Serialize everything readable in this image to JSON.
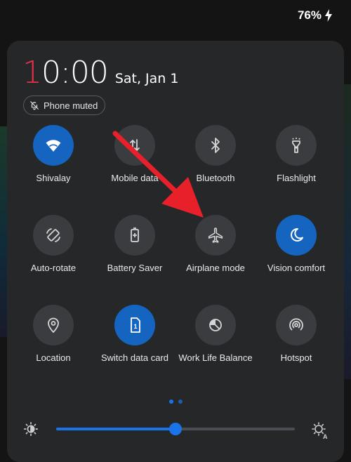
{
  "status_bar": {
    "battery_text": "76%",
    "battery_icon": "charging-bolt-icon"
  },
  "header": {
    "time_first_char": "1",
    "time_rest": "0:00",
    "date": "Sat, Jan 1",
    "chip": {
      "label": "Phone muted",
      "icon": "bell-off-icon"
    }
  },
  "tiles": [
    {
      "label": "Shivalay",
      "icon": "wifi-icon",
      "active": true
    },
    {
      "label": "Mobile data",
      "icon": "mobile-data-icon",
      "active": false
    },
    {
      "label": "Bluetooth",
      "icon": "bluetooth-icon",
      "active": false
    },
    {
      "label": "Flashlight",
      "icon": "flashlight-icon",
      "active": false
    },
    {
      "label": "Auto-rotate",
      "icon": "auto-rotate-icon",
      "active": false
    },
    {
      "label": "Battery Saver",
      "icon": "battery-saver-icon",
      "active": false
    },
    {
      "label": "Airplane mode",
      "icon": "airplane-icon",
      "active": false
    },
    {
      "label": "Vision comfort",
      "icon": "moon-icon",
      "active": true
    },
    {
      "label": "Location",
      "icon": "location-pin-icon",
      "active": false
    },
    {
      "label": "Switch data card",
      "icon": "sim-card-icon",
      "active": true
    },
    {
      "label": "Work Life Balance",
      "icon": "work-life-balance-icon",
      "active": false
    },
    {
      "label": "Hotspot",
      "icon": "hotspot-icon",
      "active": false
    }
  ],
  "pager": {
    "pages": 2,
    "current": 1
  },
  "brightness": {
    "level": 0.5,
    "low_icon": "brightness-low-icon",
    "auto_icon": "brightness-auto-icon"
  },
  "colors": {
    "accent": "#1565c0",
    "panel": "#262729",
    "tile_off": "#3b3c3f",
    "annotation_arrow": "#e8202a"
  }
}
